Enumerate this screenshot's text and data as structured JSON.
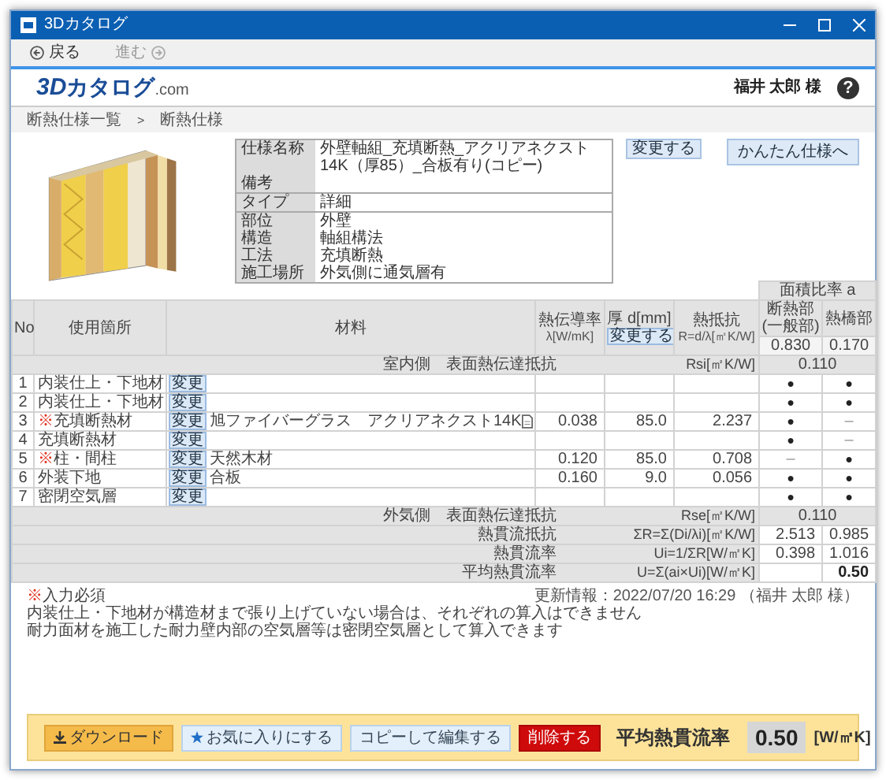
{
  "window": {
    "title": "3Dカタログ"
  },
  "nav": [
    {
      "label": "戻る",
      "kind": "back",
      "disabled": false
    },
    {
      "label": "進む",
      "kind": "forward",
      "disabled": true
    }
  ],
  "header": {
    "logo": {
      "main": "3D",
      "katakana": "カタログ",
      "suffix": ".com"
    },
    "user": "福井 太郎 様",
    "help": "?"
  },
  "breadcrumb": {
    "separator": ">",
    "items": [
      {
        "label": "断熱仕様一覧"
      },
      {
        "label": "断熱仕様"
      }
    ]
  },
  "spec": {
    "groups": [
      [
        {
          "label": "仕様名称",
          "value": "外壁軸組_充填断熱_アクリアネクスト14K（厚85）_合板有り(コピー)"
        },
        {
          "label": "備考"
        }
      ],
      [
        {
          "label": "タイプ",
          "value": "詳細"
        }
      ],
      [
        {
          "label": "部位",
          "value": "外壁"
        },
        {
          "label": "構造",
          "value": "軸組構法"
        },
        {
          "label": "工法",
          "value": "充填断熱"
        },
        {
          "label": "施工場所",
          "value": "外気側に通気層有"
        }
      ]
    ],
    "change_button": "変更する",
    "simple_button": "かんたん仕様へ"
  },
  "table": {
    "columns": {
      "no": "No",
      "place": "使用箇所",
      "material": "材料",
      "lambda": {
        "title": "熱伝導率",
        "unit": "λ[W/mK]"
      },
      "thickness": {
        "title": "厚 d[mm]",
        "button": "変更する"
      },
      "resistance": {
        "title": "熱抵抗",
        "unit": "R=d/λ[㎡K/W]"
      },
      "area_ratio": {
        "title": "面積比率 a",
        "columns": [
          {
            "title": "断熱部",
            "sub": "(一般部)",
            "ratio": "0.830"
          },
          {
            "title": "熱橋部",
            "ratio": "0.170"
          }
        ]
      }
    },
    "inside": {
      "label": "室内側　表面熱伝達抵抗",
      "formula": "Rsi[㎡K/W]",
      "value": "0.110"
    },
    "rows": [
      {
        "no": "1",
        "place": "内装仕上・下地材",
        "button": "変更",
        "doc": false,
        "insulated": "●",
        "bridge": "●"
      },
      {
        "no": "2",
        "place": "内装仕上・下地材",
        "button": "変更",
        "doc": false,
        "insulated": "●",
        "bridge": "●"
      },
      {
        "no": "3",
        "mark": "※",
        "place": "充填断熱材",
        "button": "変更",
        "material": "旭ファイバーグラス　アクリアネクスト14K",
        "doc": true,
        "lambda": "0.038",
        "thickness": "85.0",
        "resistance": "2.237",
        "insulated": "●",
        "bridge": "–"
      },
      {
        "no": "4",
        "place": "充填断熱材",
        "button": "変更",
        "doc": false,
        "insulated": "●",
        "bridge": "–"
      },
      {
        "no": "5",
        "mark": "※",
        "place": "柱・間柱",
        "button": "変更",
        "material": "天然木材",
        "doc": false,
        "lambda": "0.120",
        "thickness": "85.0",
        "resistance": "0.708",
        "insulated": "–",
        "bridge": "●"
      },
      {
        "no": "6",
        "place": "外装下地",
        "button": "変更",
        "material": "合板",
        "doc": false,
        "lambda": "0.160",
        "thickness": "9.0",
        "resistance": "0.056",
        "insulated": "●",
        "bridge": "●"
      },
      {
        "no": "7",
        "place": "密閉空気層",
        "button": "変更",
        "doc": false,
        "insulated": "●",
        "bridge": "●"
      }
    ],
    "summary": [
      {
        "kind": "span",
        "label": "外気側　表面熱伝達抵抗",
        "formula": "Rse[㎡K/W]",
        "value": "0.110"
      },
      {
        "kind": "pair",
        "label": "熱貫流抵抗",
        "formula": "ΣR=Σ(Di/λi)[㎡K/W]",
        "values": [
          "2.513",
          "0.985"
        ]
      },
      {
        "kind": "pair",
        "label": "熱貫流率",
        "formula": "Ui=1/ΣR[W/㎡K]",
        "values": [
          "0.398",
          "1.016"
        ]
      },
      {
        "kind": "total",
        "label": "平均熱貫流率",
        "formula": "U=Σ(ai×Ui)[W/㎡K]",
        "value": "0.50"
      }
    ]
  },
  "notes": {
    "required_mark": "※",
    "required_label": "入力必須",
    "updated": "更新情報：2022/07/20 16:29 （福井 太郎 様）",
    "lines": [
      "内装仕上・下地材が構造材まで張り上げていない場合は、それぞれの算入はできません",
      "耐力面材を施工した耐力壁内部の空気層等は密閉空気層として算入できます"
    ]
  },
  "footer": {
    "buttons": [
      {
        "label": "ダウンロード",
        "kind": "download"
      },
      {
        "label": "お気に入りにする",
        "kind": "favorite"
      },
      {
        "label": "コピーして編集する",
        "kind": "copy"
      },
      {
        "label": "削除する",
        "kind": "delete"
      }
    ],
    "result": {
      "label": "平均熱貫流率",
      "value": "0.50",
      "unit": "[W/㎡K]"
    }
  }
}
